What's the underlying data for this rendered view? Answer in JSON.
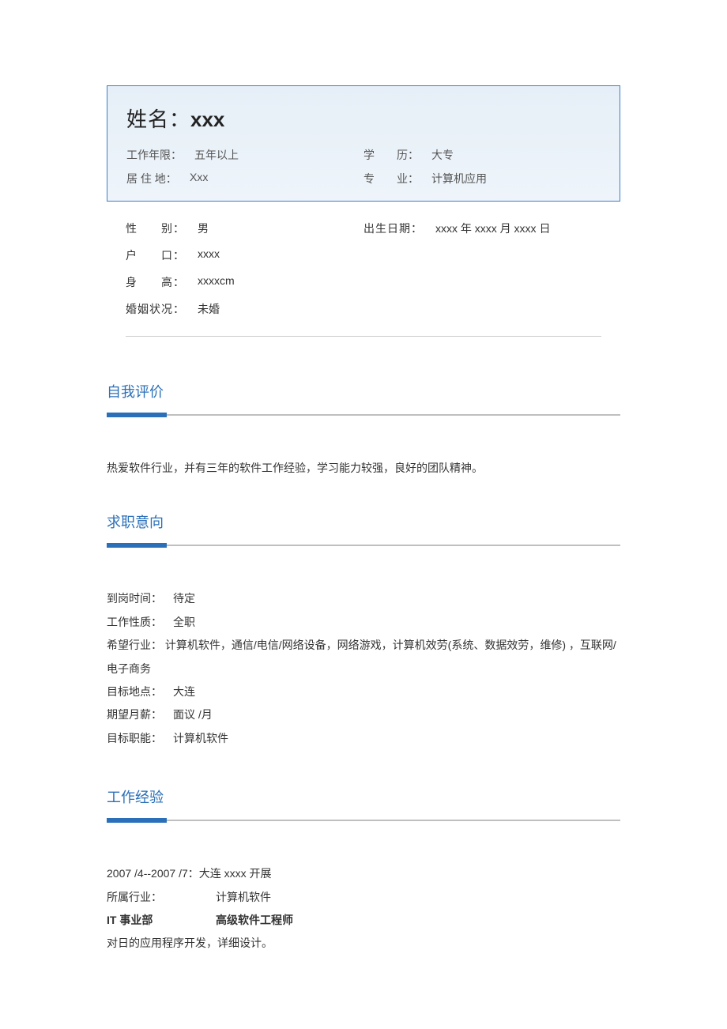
{
  "header": {
    "name_label": "姓名：",
    "name_value": "xxx",
    "work_years_label": "工作年限：",
    "work_years_value": "五年以上",
    "education_label": "学　　历：",
    "education_value": "大专",
    "residence_label": "居 住 地：",
    "residence_value": "Xxx",
    "major_label": "专　　业：",
    "major_value": "计算机应用"
  },
  "sub": {
    "gender_label": "性　　别：",
    "gender_value": "男",
    "birth_label": "出生日期：",
    "birth_value": "xxxx 年 xxxx 月 xxxx 日",
    "hukou_label": "户　　口：",
    "hukou_value": "xxxx",
    "height_label": "身　　高：",
    "height_value": "xxxxcm",
    "marital_label": "婚姻状况：",
    "marital_value": "未婚"
  },
  "self_eval": {
    "title": "自我评价",
    "body": "热爱软件行业，并有三年的软件工作经验，学习能力较强，良好的团队精神。"
  },
  "job_intent": {
    "title": "求职意向",
    "arrival_label": "到岗时间：",
    "arrival_value": "待定",
    "nature_label": "工作性质：",
    "nature_value": "全职",
    "industry_label": "希望行业：",
    "industry_value": "计算机软件，通信/电信/网络设备，网络游戏，计算机效劳(系统、数据效劳，维修) ，互联网/电子商务",
    "location_label": "目标地点：",
    "location_value": "大连",
    "salary_label": "期望月薪：",
    "salary_value": "面议 /月",
    "function_label": "目标职能：",
    "function_value": "计算机软件"
  },
  "work_exp": {
    "title": "工作经验",
    "period_company": "2007 /4--2007 /7：大连 xxxx 开展",
    "industry_label": "所属行业：",
    "industry_value": "计算机软件",
    "dept_label": "IT 事业部",
    "position_value": "高级软件工程师",
    "desc": "对日的应用程序开发，详细设计。"
  }
}
